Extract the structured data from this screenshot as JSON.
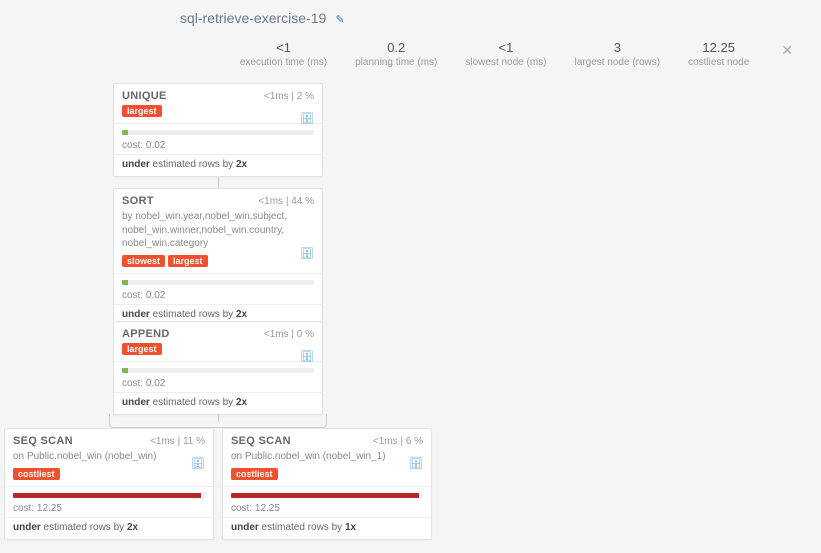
{
  "header": {
    "title": "sql-retrieve-exercise-19"
  },
  "stats": {
    "execution": {
      "val": "<1",
      "lbl": "execution time (ms)"
    },
    "planning": {
      "val": "0.2",
      "lbl": "planning time (ms)"
    },
    "slowest": {
      "val": "<1",
      "lbl": "slowest node (ms)"
    },
    "largest": {
      "val": "3",
      "lbl": "largest node (rows)"
    },
    "costliest": {
      "val": "12.25",
      "lbl": "costliest node"
    }
  },
  "nodes": {
    "unique": {
      "title": "UNIQUE",
      "meta": "<1ms | 2 %",
      "badges": [
        "largest"
      ],
      "barColor": "green",
      "barPct": 3,
      "cost": "cost: 0.02",
      "estPrefix": "under",
      "estRest": " estimated rows by ",
      "estFactor": "2x"
    },
    "sort": {
      "title": "SORT",
      "meta": "<1ms | 44 %",
      "sub": "by nobel_win.year,nobel_win.subject, nobel_win.winner,nobel_win.country, nobel_win.category",
      "badges": [
        "slowest",
        "largest"
      ],
      "barColor": "green",
      "barPct": 3,
      "cost": "cost: 0.02",
      "estPrefix": "under",
      "estRest": " estimated rows by ",
      "estFactor": "2x"
    },
    "append": {
      "title": "APPEND",
      "meta": "<1ms | 0 %",
      "badges": [
        "largest"
      ],
      "barColor": "green",
      "barPct": 3,
      "cost": "cost: 0.02",
      "estPrefix": "under",
      "estRest": " estimated rows by ",
      "estFactor": "2x"
    },
    "seq1": {
      "title": "SEQ SCAN",
      "meta": "<1ms | 11 %",
      "sub": "on Public.nobel_win (nobel_win)",
      "badges": [
        "costliest"
      ],
      "barColor": "red",
      "barPct": 98,
      "cost": "cost: 12.25",
      "estPrefix": "under",
      "estRest": " estimated rows by ",
      "estFactor": "2x"
    },
    "seq2": {
      "title": "SEQ SCAN",
      "meta": "<1ms | 6 %",
      "sub": "on Public.nobel_win (nobel_win_1)",
      "badges": [
        "costliest"
      ],
      "barColor": "red",
      "barPct": 98,
      "cost": "cost: 12.25",
      "estPrefix": "under",
      "estRest": " estimated rows by ",
      "estFactor": "1x"
    }
  }
}
